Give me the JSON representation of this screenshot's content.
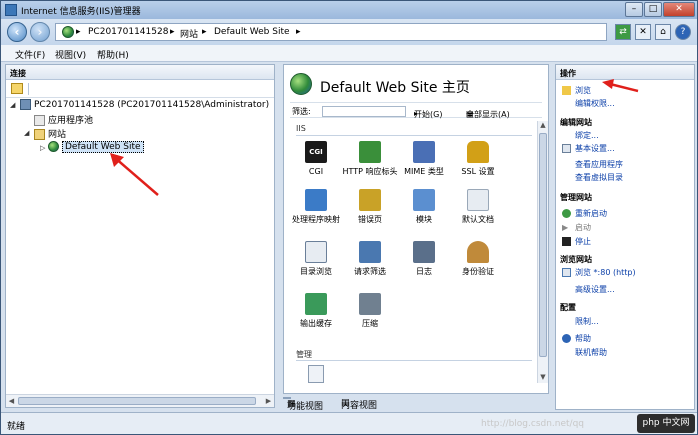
{
  "window": {
    "title": "Internet 信息服务(IIS)管理器",
    "minimize": "–",
    "maximize": "□",
    "close": "✕"
  },
  "address": {
    "crumbs": [
      "PC201701141528",
      "网站",
      "Default Web Site"
    ],
    "separator": "▸"
  },
  "menu": [
    "文件(F)",
    "视图(V)",
    "帮助(H)"
  ],
  "connections": {
    "header": "连接",
    "tree": {
      "server": "PC201701141528 (PC201701141528\\Administrator)",
      "app_pools": "应用程序池",
      "sites": "网站",
      "site": "Default Web Site"
    }
  },
  "center": {
    "title": "Default Web Site 主页",
    "filter_label": "筛选:",
    "start_label": "开始(G)",
    "show_all_label": "全部显示(A)",
    "section_iis": "IIS",
    "section_manage": "管理",
    "features": [
      {
        "label": "CGI",
        "icon": "cgi-icon",
        "color": "#1a1a1a"
      },
      {
        "label": "HTTP 响应标头",
        "icon": "http-headers-icon",
        "color": "#3a8f3a"
      },
      {
        "label": "MIME 类型",
        "icon": "mime-types-icon",
        "color": "#4a6fb5"
      },
      {
        "label": "SSL 设置",
        "icon": "ssl-lock-icon",
        "color": "#d2a017"
      },
      {
        "label": "处理程序映射",
        "icon": "handler-mappings-icon",
        "color": "#3b7bc7"
      },
      {
        "label": "错误页",
        "icon": "error-pages-icon",
        "color": "#c9a227"
      },
      {
        "label": "模块",
        "icon": "modules-icon",
        "color": "#5b8fd0"
      },
      {
        "label": "默认文档",
        "icon": "default-document-icon",
        "color": "#9aa8b8"
      },
      {
        "label": "目录浏览",
        "icon": "directory-browsing-icon",
        "color": "#6a7f99"
      },
      {
        "label": "请求筛选",
        "icon": "request-filtering-icon",
        "color": "#4a78b0"
      },
      {
        "label": "日志",
        "icon": "logging-icon",
        "color": "#5a6f8a"
      },
      {
        "label": "身份验证",
        "icon": "authentication-icon",
        "color": "#c08a3a"
      },
      {
        "label": "输出缓存",
        "icon": "output-caching-icon",
        "color": "#3a9a5a"
      },
      {
        "label": "压缩",
        "icon": "compression-icon",
        "color": "#708090"
      }
    ],
    "view_tabs": {
      "features": "功能视图",
      "content": "内容视图"
    }
  },
  "actions": {
    "header": "操作",
    "items": [
      {
        "label": "浏览",
        "type": "link",
        "icon": "explore-icon"
      },
      {
        "label": "编辑权限...",
        "type": "link"
      },
      {
        "label": "编辑网站",
        "type": "group"
      },
      {
        "label": "绑定...",
        "type": "link"
      },
      {
        "label": "基本设置...",
        "type": "link",
        "icon": "settings-icon"
      },
      {
        "label": "查看应用程序",
        "type": "link"
      },
      {
        "label": "查看虚拟目录",
        "type": "link"
      },
      {
        "label": "管理网站",
        "type": "group"
      },
      {
        "label": "重新启动",
        "type": "link",
        "icon": "restart-icon"
      },
      {
        "label": "启动",
        "type": "disabled",
        "icon": "start-icon"
      },
      {
        "label": "停止",
        "type": "link",
        "icon": "stop-icon"
      },
      {
        "label": "浏览网站",
        "type": "group"
      },
      {
        "label": "浏览 *:80 (http)",
        "type": "link",
        "icon": "browse-http-icon"
      },
      {
        "label": "高级设置...",
        "type": "link"
      },
      {
        "label": "配置",
        "type": "group"
      },
      {
        "label": "限制...",
        "type": "link"
      },
      {
        "label": "帮助",
        "type": "link",
        "icon": "help-icon"
      },
      {
        "label": "联机帮助",
        "type": "link"
      }
    ]
  },
  "status": {
    "text": "就绪"
  },
  "watermark": "http://blog.csdn.net/qq",
  "site_logo": "php 中文网",
  "accent_color": "#0b3fa8",
  "arrow_color": "#e0201b"
}
